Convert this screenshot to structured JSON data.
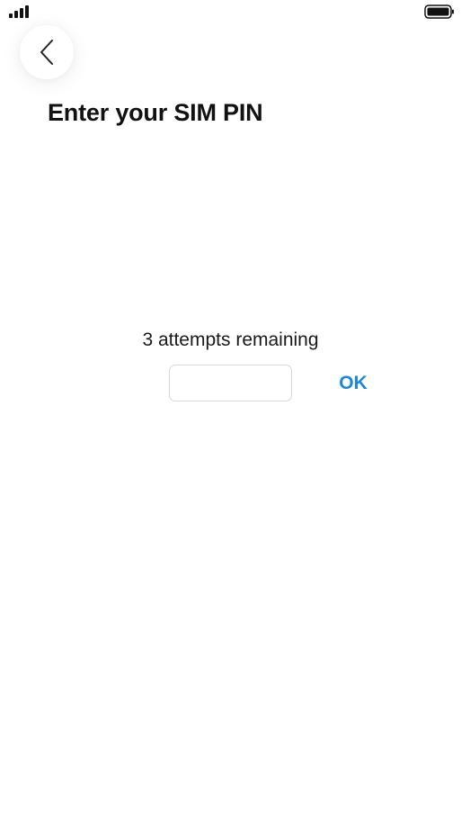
{
  "status_bar": {
    "signal_icon": "signal-bars-icon",
    "battery_icon": "battery-full-icon"
  },
  "header": {
    "back_icon": "chevron-left-icon",
    "title": "Enter your SIM PIN"
  },
  "pin_form": {
    "attempts_text": "3 attempts remaining",
    "pin_value": "",
    "pin_placeholder": "",
    "ok_label": "OK"
  },
  "colors": {
    "accent": "#1e88d8",
    "text": "#111111",
    "background": "#ffffff",
    "input_border": "#d8d8d8"
  }
}
